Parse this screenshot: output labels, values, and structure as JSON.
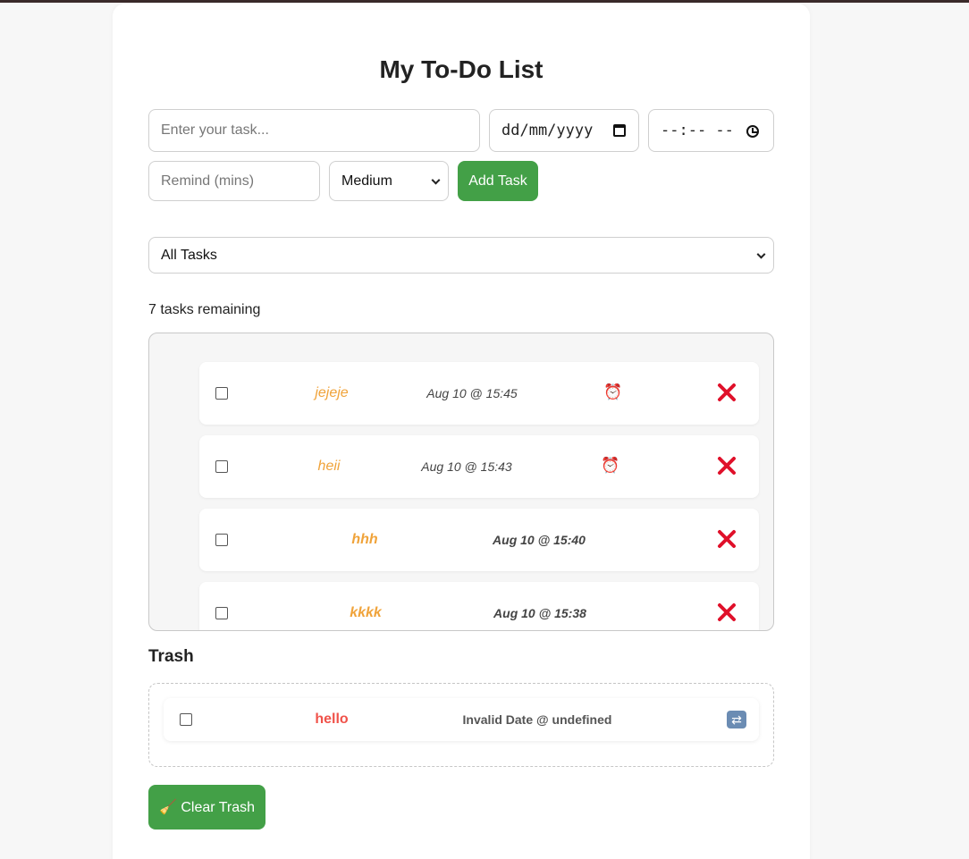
{
  "title": "My To-Do List",
  "form": {
    "task_placeholder": "Enter your task...",
    "date_placeholder": "dd/mm/yyyy",
    "time_placeholder": "--:-- --",
    "remind_placeholder": "Remind (mins)",
    "priority_selected": "Medium",
    "add_button": "Add Task"
  },
  "filter": {
    "selected": "All Tasks"
  },
  "remaining_text": "7 tasks remaining",
  "tasks": [
    {
      "name": "jejeje",
      "date": "Aug 10 @ 15:45",
      "has_alarm": true,
      "style": "italic"
    },
    {
      "name": "heii",
      "date": "Aug 10 @ 15:43",
      "has_alarm": true,
      "style": "italic"
    },
    {
      "name": "hhh",
      "date": "Aug 10 @ 15:40",
      "has_alarm": false,
      "style": "bold-italic"
    },
    {
      "name": "kkkk",
      "date": "Aug 10 @ 15:38",
      "has_alarm": false,
      "style": "bold-italic"
    }
  ],
  "trash": {
    "title": "Trash",
    "items": [
      {
        "name": "hello",
        "date": "Invalid Date @ undefined"
      }
    ],
    "clear_button": "🧹 Clear Trash"
  },
  "colors": {
    "accent_green": "#43a047",
    "task_name": "#f0a33a",
    "trash_name": "#f0524a",
    "delete_red": "#e0102a"
  }
}
